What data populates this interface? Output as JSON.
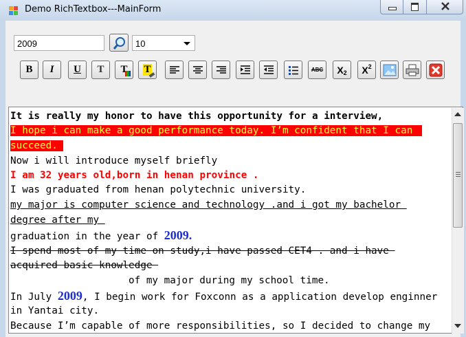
{
  "window": {
    "title": "Demo RichTextbox---MainForm",
    "icon": "app-window-icon",
    "controls": [
      "minimize-icon",
      "maximize-icon",
      "close-icon"
    ]
  },
  "toolbar": {
    "font_value": "2009",
    "size_value": "10",
    "buttons": [
      {
        "name": "bold-button",
        "label": "B"
      },
      {
        "name": "italic-button",
        "label": "I"
      },
      {
        "name": "underline-button",
        "label": "U"
      },
      {
        "name": "strikeout-button",
        "label": "T"
      },
      {
        "name": "text-color-button",
        "label": "T"
      },
      {
        "name": "highlight-button",
        "label": "T"
      },
      {
        "name": "align-left-button",
        "icon": "align-left-icon"
      },
      {
        "name": "align-center-button",
        "icon": "align-center-icon"
      },
      {
        "name": "align-right-button",
        "icon": "align-right-icon"
      },
      {
        "name": "indent-button",
        "icon": "indent-icon"
      },
      {
        "name": "outdent-button",
        "icon": "outdent-icon"
      },
      {
        "name": "bullets-button",
        "icon": "bullet-list-icon"
      },
      {
        "name": "spellcheck-button",
        "label": "ABC"
      },
      {
        "name": "subscript-button",
        "label": "X",
        "sub": "2"
      },
      {
        "name": "superscript-button",
        "label": "X",
        "sup": "2"
      },
      {
        "name": "insert-image-button",
        "icon": "image-icon"
      },
      {
        "name": "print-button",
        "icon": "printer-icon"
      },
      {
        "name": "close-doc-button",
        "icon": "red-x-icon"
      }
    ]
  },
  "document": {
    "line1": "It is really my honor to have this opportunity for a interview,",
    "line2": "I hope i can make a good performance today. I’m confident that I can",
    "line3": "succeed.",
    "line4": "Now i will introduce myself briefly",
    "line5": "I am 32 years old,born in henan province .",
    "line6": "I was graduated from henan polytechnic university.",
    "line7": "my major is computer science and technology .and i got my bachelor ",
    "line8": "degree after my ",
    "line9_pre": "graduation in the year of ",
    "line9_year": "2009",
    "line9_post": ".",
    "line10": "I spend most of my time on study,i have passed CET4 . and i have ",
    "line11": "acquired basic knowledge ",
    "line12": "of my major during my school time.",
    "line13_pre": "In July ",
    "line13_year": "2009",
    "line13_post": ", I begin work for Foxconn as a application develop enginner",
    "line14": "in Yantai city.",
    "line15": "Because I’m capable of more responsibilities, so I decided to change my"
  },
  "colors": {
    "highlight_bg": "#ff0000",
    "highlight_text": "#ffff33",
    "red_text": "#ff0000",
    "blue_year": "#1c2ed1"
  }
}
